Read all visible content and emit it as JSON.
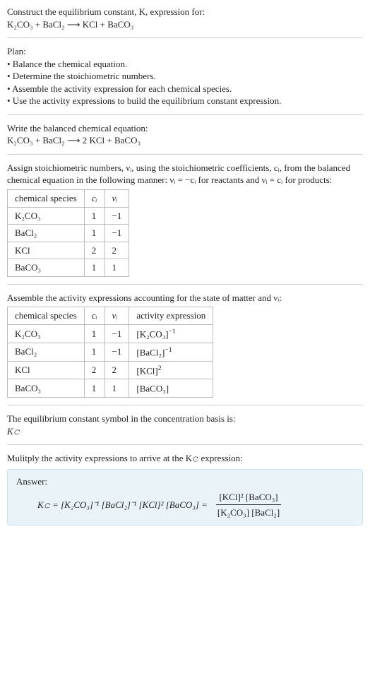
{
  "header": {
    "line1": "Construct the equilibrium constant, K, expression for:",
    "reaction": "K₂CO₃ + BaCl₂ ⟶ KCl + BaCO₃"
  },
  "plan": {
    "title": "Plan:",
    "b1": "• Balance the chemical equation.",
    "b2": "• Determine the stoichiometric numbers.",
    "b3": "• Assemble the activity expression for each chemical species.",
    "b4": "• Use the activity expressions to build the equilibrium constant expression."
  },
  "balanced": {
    "title": "Write the balanced chemical equation:",
    "reaction": "K₂CO₃ + BaCl₂ ⟶ 2 KCl + BaCO₃"
  },
  "stoich_text": {
    "part1": "Assign stoichiometric numbers, νᵢ, using the stoichiometric coefficients, cᵢ, from the balanced chemical equation in the following manner: νᵢ = −cᵢ for reactants and νᵢ = cᵢ for products:"
  },
  "table1": {
    "h1": "chemical species",
    "h2": "cᵢ",
    "h3": "νᵢ",
    "rows": [
      {
        "s": "K₂CO₃",
        "c": "1",
        "v": "−1"
      },
      {
        "s": "BaCl₂",
        "c": "1",
        "v": "−1"
      },
      {
        "s": "KCl",
        "c": "2",
        "v": "2"
      },
      {
        "s": "BaCO₃",
        "c": "1",
        "v": "1"
      }
    ]
  },
  "activity_text": "Assemble the activity expressions accounting for the state of matter and νᵢ:",
  "table2": {
    "h1": "chemical species",
    "h2": "cᵢ",
    "h3": "νᵢ",
    "h4": "activity expression",
    "rows": [
      {
        "s": "K₂CO₃",
        "c": "1",
        "v": "−1",
        "a_base": "[K₂CO₃]",
        "a_exp": "−1"
      },
      {
        "s": "BaCl₂",
        "c": "1",
        "v": "−1",
        "a_base": "[BaCl₂]",
        "a_exp": "−1"
      },
      {
        "s": "KCl",
        "c": "2",
        "v": "2",
        "a_base": "[KCl]",
        "a_exp": "2"
      },
      {
        "s": "BaCO₃",
        "c": "1",
        "v": "1",
        "a_base": "[BaCO₃]",
        "a_exp": ""
      }
    ]
  },
  "eq_symbol": {
    "line": "The equilibrium constant symbol in the concentration basis is:",
    "sym": "K𝚌"
  },
  "multiply_line": "Mulitply the activity expressions to arrive at the K𝚌 expression:",
  "answer": {
    "label": "Answer:",
    "lhs": "K𝚌 = [K₂CO₃]⁻¹ [BaCl₂]⁻¹ [KCl]² [BaCO₃] =",
    "num": "[KCl]² [BaCO₃]",
    "den": "[K₂CO₃] [BaCl₂]"
  }
}
